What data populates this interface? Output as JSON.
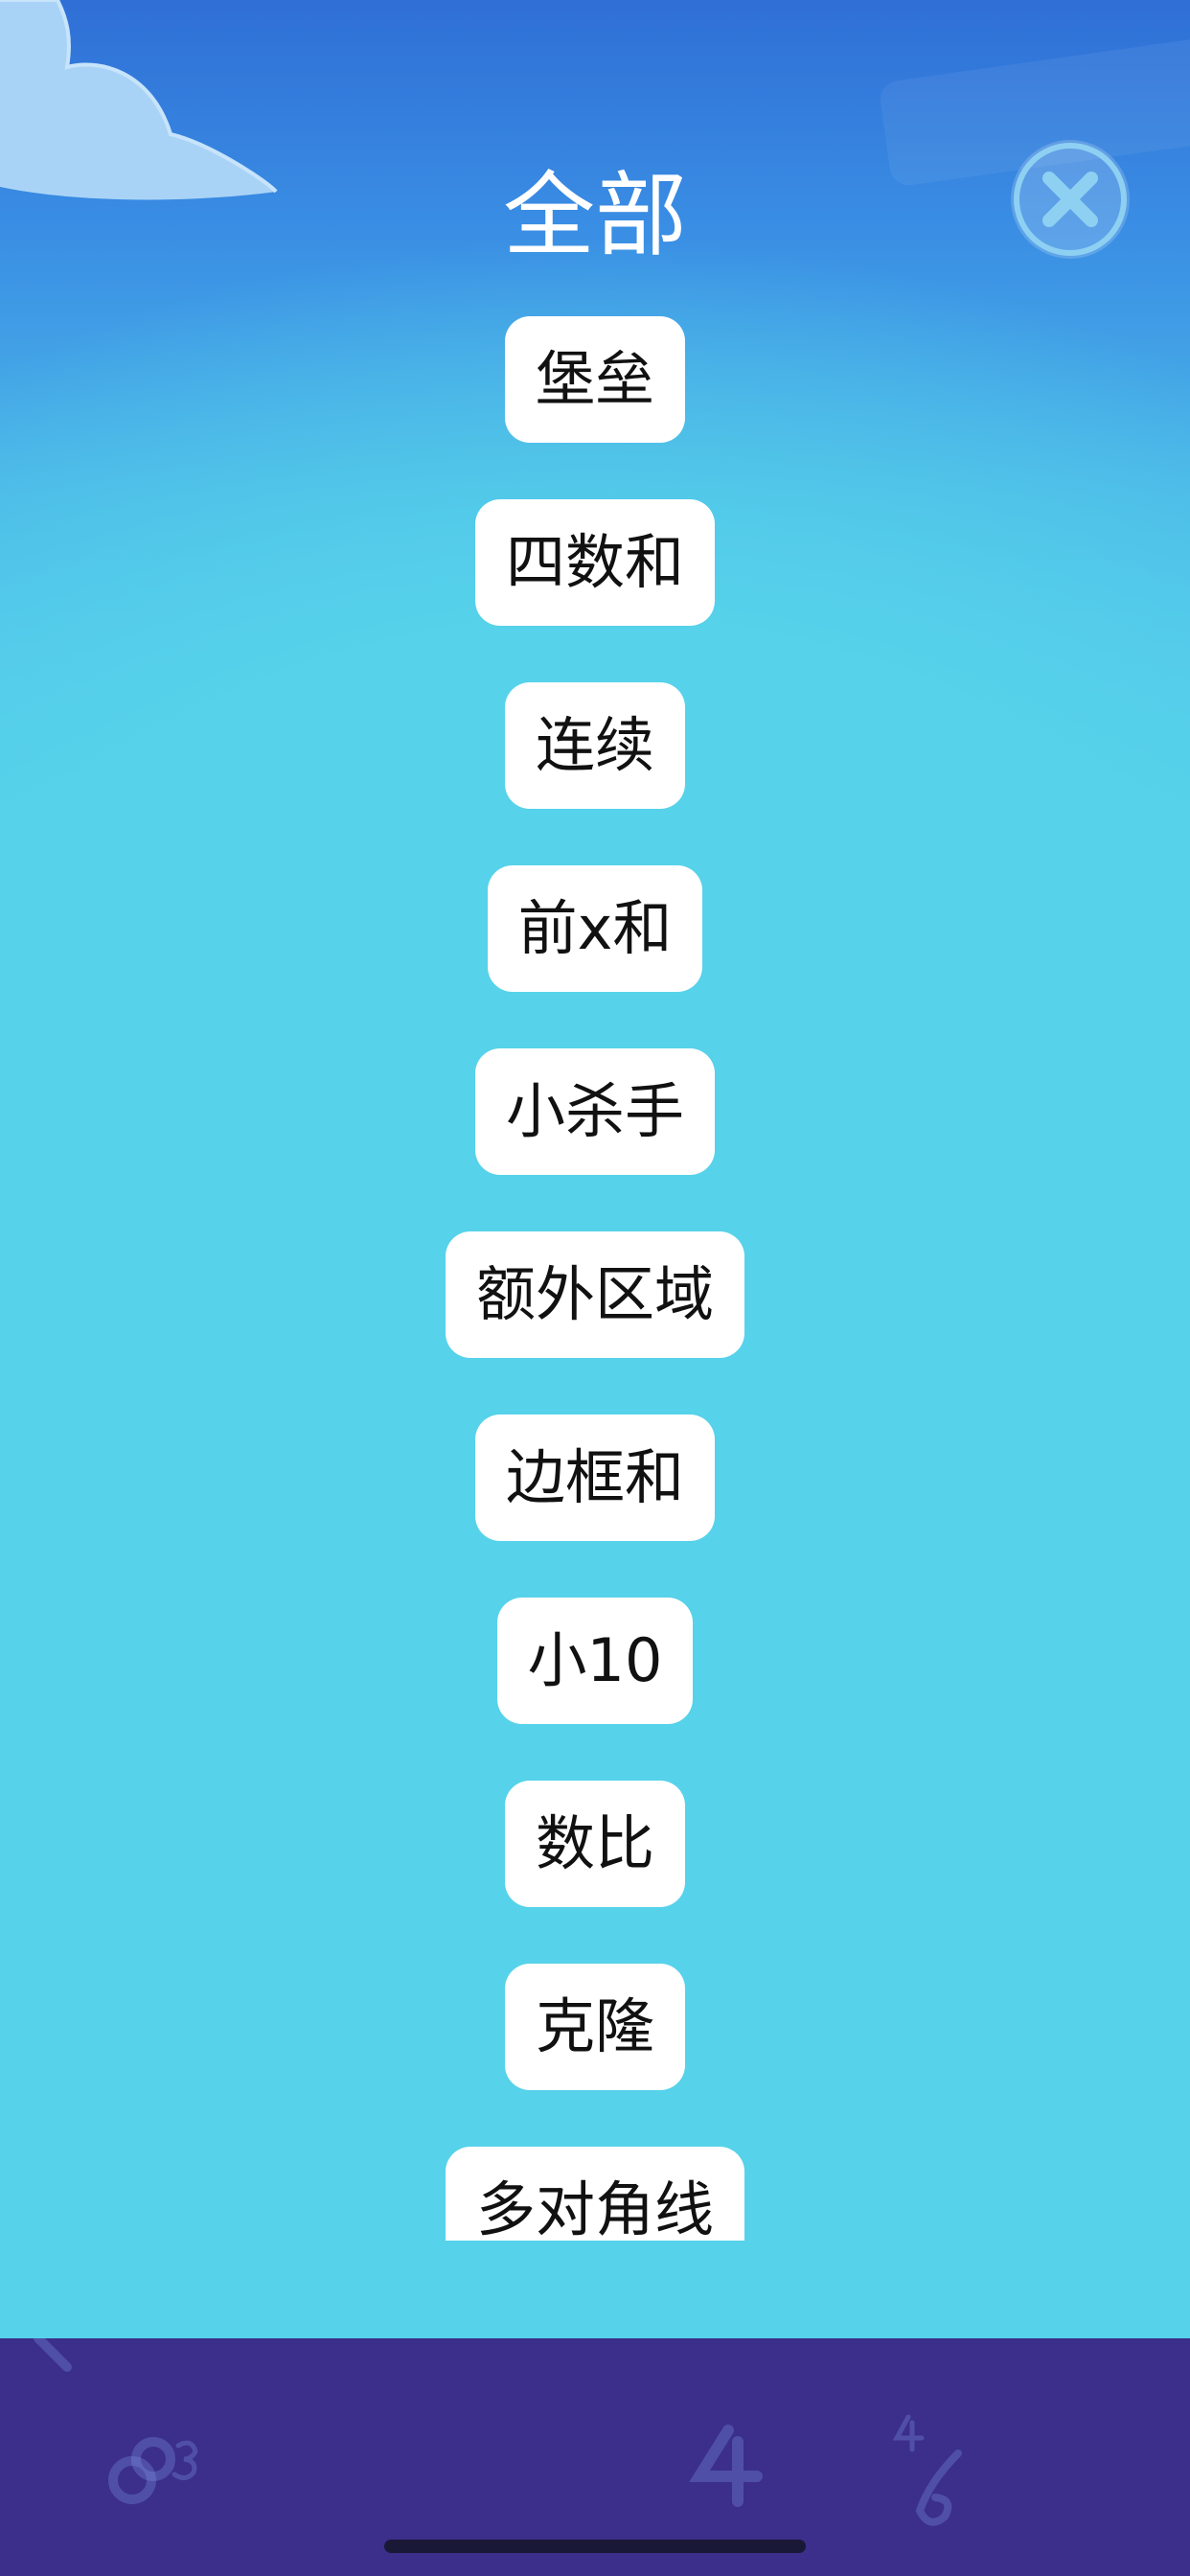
{
  "header": {
    "title": "全部",
    "close_icon": "close-circle-icon"
  },
  "items": [
    {
      "label": "堡垒"
    },
    {
      "label": "四数和"
    },
    {
      "label": "连续"
    },
    {
      "label": "前x和"
    },
    {
      "label": "小杀手"
    },
    {
      "label": "额外区域"
    },
    {
      "label": "边框和"
    },
    {
      "label": "小10"
    },
    {
      "label": "数比"
    },
    {
      "label": "克隆"
    },
    {
      "label": "多对角线"
    }
  ],
  "colors": {
    "sky_top": "#2f6fd6",
    "sky_main": "#56d2ea",
    "chip_bg": "#ffffff",
    "chip_text": "#111111",
    "bottom_bar": "#3b2f8b"
  }
}
